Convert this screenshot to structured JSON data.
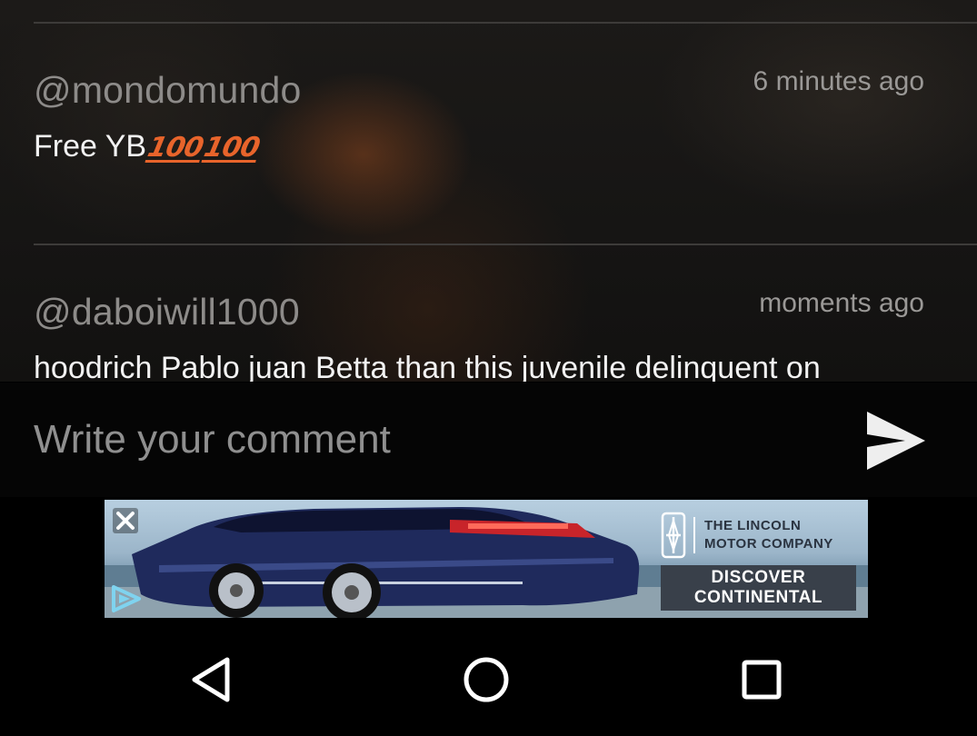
{
  "comments": [
    {
      "username": "@mondomundo",
      "time": "6 minutes ago",
      "text": "Free YB",
      "emoji": [
        "💯",
        "💯"
      ]
    },
    {
      "username": "@daboiwill1000",
      "time": "moments ago",
      "text": "hoodrich Pablo juan Betta than this juvenile delinquent on"
    }
  ],
  "composer": {
    "placeholder": "Write your comment",
    "send_icon": "send-icon"
  },
  "ad": {
    "brand": "THE LINCOLN\nMOTOR COMPANY",
    "cta": "DISCOVER\nCONTINENTAL",
    "close_icon": "close-icon",
    "play_icon": "play-badge-icon"
  },
  "navbar": {
    "icons": [
      "back-icon",
      "home-icon",
      "recents-icon"
    ]
  },
  "colors": {
    "emoji_accent": "#e8642b",
    "username": "#8d8b89",
    "text": "#f2f2f2"
  }
}
